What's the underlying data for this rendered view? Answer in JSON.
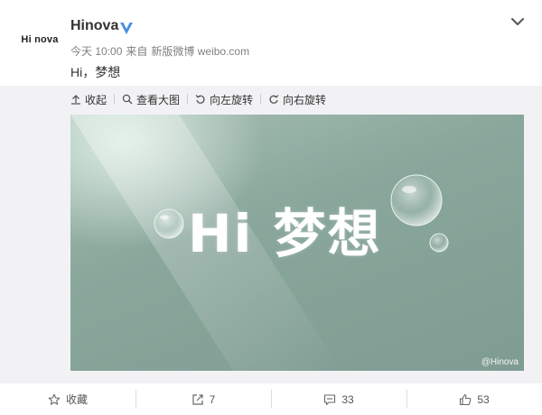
{
  "post": {
    "avatar_text": "Hi nova",
    "user_name": "Hinova",
    "verified": true,
    "time": "今天 10:00",
    "source_prefix": "来自",
    "source": "新版微博 weibo.com",
    "text": "Hi，梦想"
  },
  "toolbar": {
    "collapse": "收起",
    "view_large": "查看大图",
    "rotate_left": "向左旋转",
    "rotate_right": "向右旋转"
  },
  "image": {
    "headline": "Hi 梦想",
    "watermark": "@Hinova"
  },
  "actions": {
    "favorite": "收藏",
    "repost_count": "7",
    "comment_count": "33",
    "like_count": "53"
  },
  "colors": {
    "verified": "#4a90e2",
    "image_bg": "#8aa79c"
  }
}
